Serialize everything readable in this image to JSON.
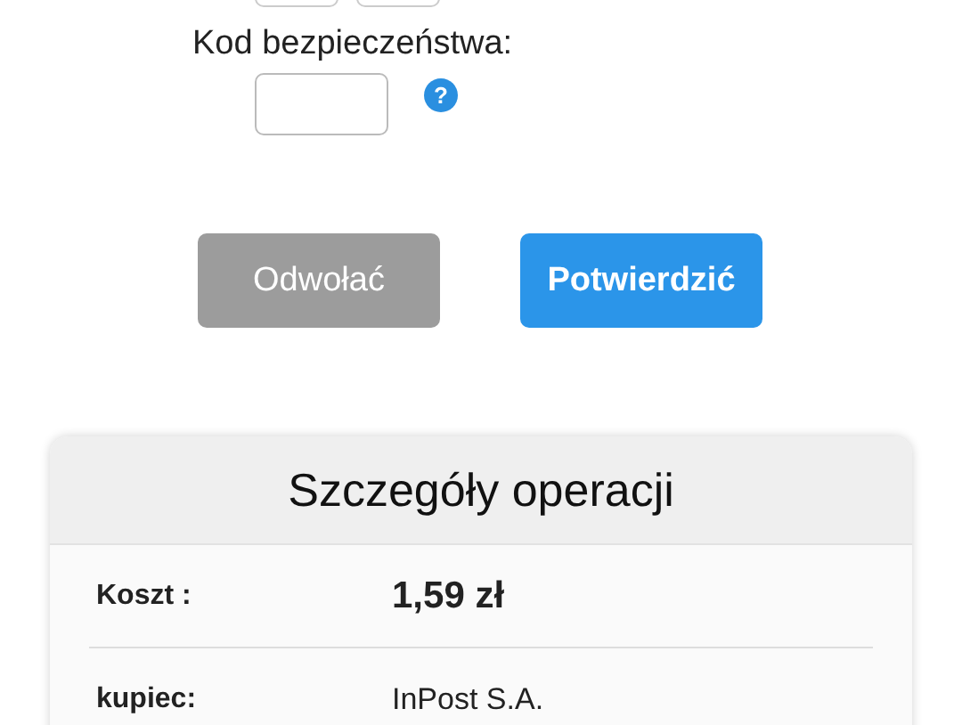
{
  "top_fields": [
    {
      "kind": "field"
    },
    {
      "kind": "field"
    }
  ],
  "security_code": {
    "label": "Kod bezpieczeństwa:",
    "help": "?"
  },
  "buttons": [
    {
      "label": "Odwołać",
      "disabled": true
    },
    {
      "label": "Potwierdzić",
      "disabled": false
    }
  ],
  "details": {
    "title": "Szczegóły operacji",
    "rows": [
      {
        "label": "Koszt :",
        "value": "1,59 zł",
        "emphasis": true
      },
      {
        "label": "kupiec:",
        "value": "InPost S.A.",
        "emphasis": false
      }
    ]
  }
}
